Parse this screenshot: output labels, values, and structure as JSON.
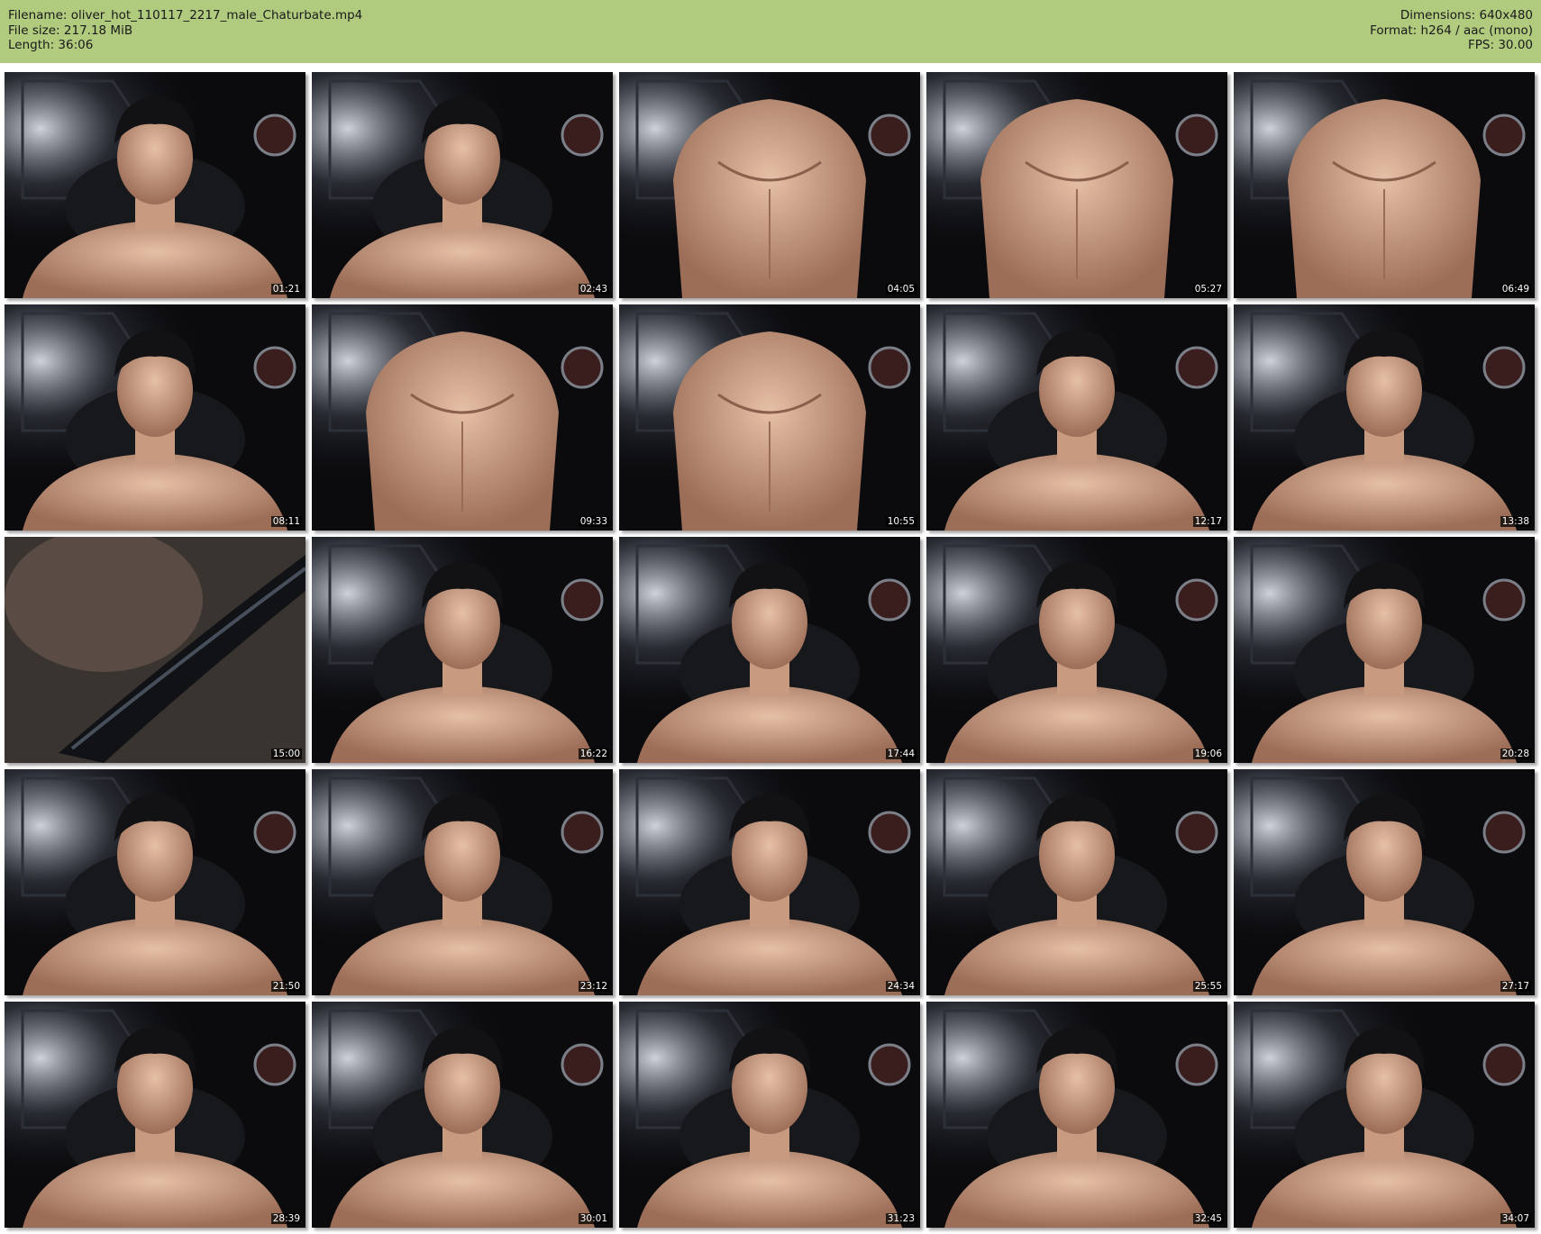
{
  "header": {
    "filename": "Filename: oliver_hot_110117_2217_male_Chaturbate.mp4",
    "filesize": "File size: 217.18 MiB",
    "length": "Length: 36:06",
    "dimensions": "Dimensions: 640x480",
    "format": "Format: h264 / aac (mono)",
    "fps": "FPS: 30.00"
  },
  "colors": {
    "header_bg": "#b0ca7e",
    "skin": "#c89a80",
    "hair": "#121214",
    "background_dark": "#0b0b0e"
  },
  "thumbnails": [
    {
      "time": "01:21",
      "shot": "face"
    },
    {
      "time": "02:43",
      "shot": "face"
    },
    {
      "time": "04:05",
      "shot": "torso"
    },
    {
      "time": "05:27",
      "shot": "torso"
    },
    {
      "time": "06:49",
      "shot": "torso"
    },
    {
      "time": "08:11",
      "shot": "face"
    },
    {
      "time": "09:33",
      "shot": "torso"
    },
    {
      "time": "10:55",
      "shot": "torso"
    },
    {
      "time": "12:17",
      "shot": "face"
    },
    {
      "time": "13:38",
      "shot": "face"
    },
    {
      "time": "15:00",
      "shot": "blur"
    },
    {
      "time": "16:22",
      "shot": "face"
    },
    {
      "time": "17:44",
      "shot": "face"
    },
    {
      "time": "19:06",
      "shot": "face"
    },
    {
      "time": "20:28",
      "shot": "face"
    },
    {
      "time": "21:50",
      "shot": "face"
    },
    {
      "time": "23:12",
      "shot": "face"
    },
    {
      "time": "24:34",
      "shot": "face"
    },
    {
      "time": "25:55",
      "shot": "face"
    },
    {
      "time": "27:17",
      "shot": "face"
    },
    {
      "time": "28:39",
      "shot": "face"
    },
    {
      "time": "30:01",
      "shot": "face"
    },
    {
      "time": "31:23",
      "shot": "face"
    },
    {
      "time": "32:45",
      "shot": "face"
    },
    {
      "time": "34:07",
      "shot": "face"
    }
  ]
}
